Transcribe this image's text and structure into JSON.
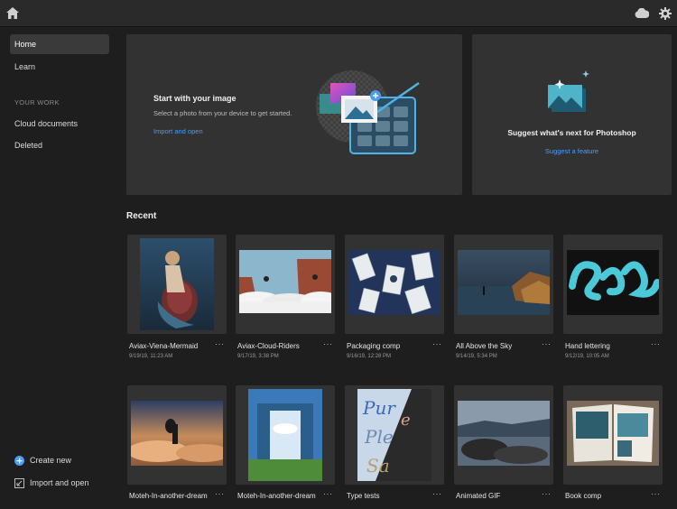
{
  "topbar": {
    "icons": [
      "home-icon",
      "cloud-icon",
      "gear-icon"
    ]
  },
  "sidebar": {
    "items": [
      {
        "label": "Home",
        "active": true
      },
      {
        "label": "Learn",
        "active": false
      }
    ],
    "section_label": "YOUR WORK",
    "work_items": [
      {
        "label": "Cloud documents"
      },
      {
        "label": "Deleted"
      }
    ],
    "actions": {
      "create_new": "Create new",
      "import_open": "Import and open"
    }
  },
  "hero": {
    "title": "Start with your image",
    "subtitle": "Select a photo from your device to get started.",
    "link": "Import and open"
  },
  "suggest": {
    "title": "Suggest what's next for Photoshop",
    "link": "Suggest a feature"
  },
  "recent": {
    "title": "Recent",
    "row1": [
      {
        "name": "Aviax-Viena-Mermaid",
        "date": "9/19/19, 11:23 AM"
      },
      {
        "name": "Aviax-Cloud-Riders",
        "date": "9/17/19, 3:38 PM"
      },
      {
        "name": "Packaging comp",
        "date": "9/16/19, 12:28 PM"
      },
      {
        "name": "All Above the Sky",
        "date": "9/14/19, 5:34 PM"
      },
      {
        "name": "Hand lettering",
        "date": "9/12/19, 10:05 AM"
      }
    ],
    "row2": [
      {
        "name": "Moteh-In-another-dream"
      },
      {
        "name": "Moteh-In-another-dream"
      },
      {
        "name": "Type tests"
      },
      {
        "name": "Animated GIF"
      },
      {
        "name": "Book comp"
      }
    ],
    "more_label": "···"
  },
  "colors": {
    "background": "#1e1e1e",
    "card": "#323232",
    "accent": "#4b9cf5",
    "active_nav": "#3a3a3a"
  }
}
